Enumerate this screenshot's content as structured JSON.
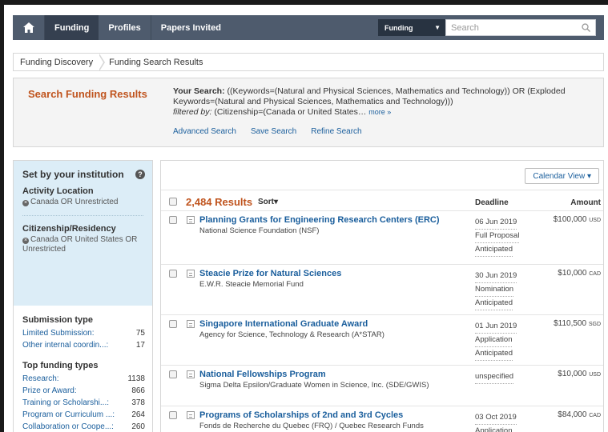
{
  "nav": {
    "items": [
      "Funding",
      "Profiles",
      "Papers Invited"
    ],
    "active": "Funding",
    "search_scope": "Funding",
    "search_placeholder": "Search"
  },
  "breadcrumb": [
    "Funding Discovery",
    "Funding Search Results"
  ],
  "summary": {
    "title": "Search Funding Results",
    "your_search_label": "Your Search:",
    "query": "((Keywords=(Natural and Physical Sciences, Mathematics and Technology)) OR (Exploded Keywords=(Natural and Physical Sciences, Mathematics and Technology)))",
    "filtered_label": "filtered by:",
    "filter": "(Citizenship=(Canada or United States…",
    "more": "more »",
    "links": [
      "Advanced Search",
      "Save Search",
      "Refine Search"
    ]
  },
  "sidebar": {
    "inst_title": "Set by your institution",
    "activity_title": "Activity Location",
    "activity_value": "Canada OR Unrestricted",
    "citizenship_title": "Citizenship/Residency",
    "citizenship_value": "Canada OR United States OR Unrestricted",
    "submission_title": "Submission type",
    "submission": [
      {
        "label": "Limited Submission:",
        "count": "75"
      },
      {
        "label": "Other internal coordin...:",
        "count": "17"
      }
    ],
    "types_title": "Top funding types",
    "types": [
      {
        "label": "Research:",
        "count": "1138"
      },
      {
        "label": "Prize or Award:",
        "count": "866"
      },
      {
        "label": "Training or Scholarshi...:",
        "count": "378"
      },
      {
        "label": "Program or Curriculum ...:",
        "count": "264"
      },
      {
        "label": "Collaboration or Coope...:",
        "count": "260"
      }
    ]
  },
  "results": {
    "calendar_label": "Calendar View ▾",
    "count_text": "2,484 Results",
    "sort_label": "Sort▾",
    "col_deadline": "Deadline",
    "col_amount": "Amount",
    "rows": [
      {
        "title": "Planning Grants for Engineering Research Centers (ERC)",
        "sponsor": "National Science Foundation (NSF)",
        "deadline": [
          "06 Jun 2019",
          "Full Proposal",
          "Anticipated"
        ],
        "amount": "$100,000",
        "currency": "USD"
      },
      {
        "title": "Steacie Prize for Natural Sciences",
        "sponsor": "E.W.R. Steacie Memorial Fund",
        "deadline": [
          "30 Jun 2019",
          "Nomination",
          "Anticipated"
        ],
        "amount": "$10,000",
        "currency": "CAD"
      },
      {
        "title": "Singapore International Graduate Award",
        "sponsor": "Agency for Science, Technology & Research (A*STAR)",
        "deadline": [
          "01 Jun 2019",
          "Application",
          "Anticipated"
        ],
        "amount": "$110,500",
        "currency": "SGD"
      },
      {
        "title": "National Fellowships Program",
        "sponsor": "Sigma Delta Epsilon/Graduate Women in Science, Inc. (SDE/GWIS)",
        "deadline": [
          "unspecified"
        ],
        "amount": "$10,000",
        "currency": "USD"
      },
      {
        "title": "Programs of Scholarships of 2nd and 3rd Cycles",
        "sponsor": "Fonds de Recherche du Quebec (FRQ) / Quebec Research Funds",
        "deadline": [
          "03 Oct 2019",
          "Application"
        ],
        "amount": "$84,000",
        "currency": "CAD"
      }
    ]
  },
  "colors": {
    "nav_bg": "#4e5b6d",
    "accent_orange": "#c0541e",
    "link_blue": "#1a5e9c",
    "inst_bg": "#dcedf7"
  }
}
